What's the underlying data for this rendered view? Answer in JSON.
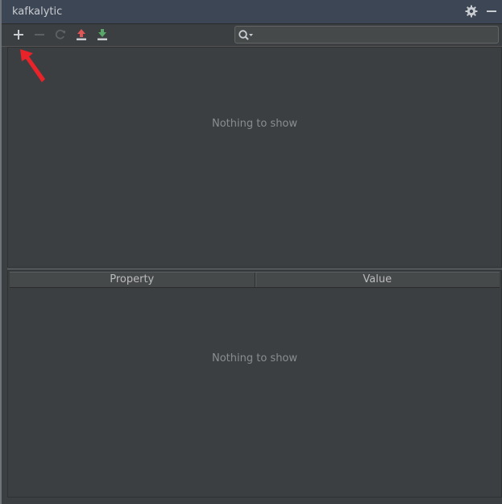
{
  "window": {
    "title": "kafkalytic",
    "settings_icon": "gear-icon",
    "minimize_icon": "minimize-icon"
  },
  "toolbar": {
    "buttons": [
      {
        "icon": "add-icon",
        "enabled": true
      },
      {
        "icon": "remove-icon",
        "enabled": false
      },
      {
        "icon": "refresh-icon",
        "enabled": false
      },
      {
        "icon": "upload-icon",
        "enabled": true,
        "color": "#e05555"
      },
      {
        "icon": "download-icon",
        "enabled": true,
        "color": "#59a869"
      }
    ],
    "search": {
      "icon": "search-icon",
      "value": "",
      "placeholder": ""
    }
  },
  "tree": {
    "empty_text": "Nothing to show"
  },
  "properties": {
    "columns": [
      "Property",
      "Value"
    ],
    "rows": [],
    "empty_text": "Nothing to show"
  },
  "annotation": {
    "icon": "red-arrow-icon",
    "color": "#e8232a"
  },
  "colors": {
    "titlebar_bg": "#3d4654",
    "panel_bg": "#3c3f41",
    "text": "#bbbbbb",
    "muted_text": "#8a8d90"
  }
}
